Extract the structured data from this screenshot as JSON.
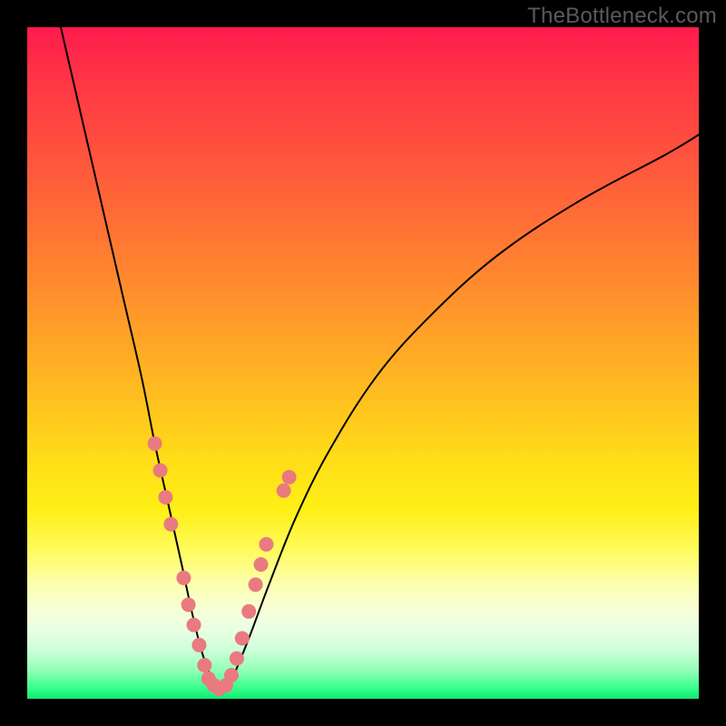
{
  "watermark": "TheBottleneck.com",
  "chart_data": {
    "type": "line",
    "title": "",
    "xlabel": "",
    "ylabel": "",
    "xlim": [
      0,
      100
    ],
    "ylim": [
      0,
      100
    ],
    "grid": false,
    "legend": false,
    "background_gradient": {
      "direction": "vertical",
      "stops": [
        {
          "pos": 0.0,
          "color": "#ff1a4d"
        },
        {
          "pos": 0.22,
          "color": "#ff5b3b"
        },
        {
          "pos": 0.52,
          "color": "#ffb522"
        },
        {
          "pos": 0.78,
          "color": "#fffb60"
        },
        {
          "pos": 0.93,
          "color": "#c9ffd6"
        },
        {
          "pos": 1.0,
          "color": "#11e873"
        }
      ]
    },
    "series": [
      {
        "name": "bottleneck-curve",
        "stroke": "#000000",
        "stroke_width": 2,
        "x": [
          5,
          8,
          11,
          14,
          17,
          19,
          21,
          23,
          24.5,
          26,
          27.5,
          29,
          30.5,
          33,
          36,
          40,
          45,
          52,
          60,
          70,
          82,
          95,
          100
        ],
        "y": [
          100,
          87,
          74,
          61,
          48,
          38,
          29,
          20,
          13,
          7,
          3,
          1,
          3,
          9,
          17,
          27,
          37,
          48,
          57,
          66,
          74,
          81,
          84
        ]
      }
    ],
    "markers": {
      "color": "#e97a7f",
      "radius": 8,
      "points": [
        {
          "x": 19.0,
          "y": 38
        },
        {
          "x": 19.8,
          "y": 34
        },
        {
          "x": 20.6,
          "y": 30
        },
        {
          "x": 21.4,
          "y": 26
        },
        {
          "x": 23.3,
          "y": 18
        },
        {
          "x": 24.0,
          "y": 14
        },
        {
          "x": 24.8,
          "y": 11
        },
        {
          "x": 25.6,
          "y": 8
        },
        {
          "x": 26.4,
          "y": 5
        },
        {
          "x": 27.0,
          "y": 3
        },
        {
          "x": 27.8,
          "y": 2
        },
        {
          "x": 28.6,
          "y": 1.5
        },
        {
          "x": 29.6,
          "y": 2
        },
        {
          "x": 30.4,
          "y": 3.5
        },
        {
          "x": 31.2,
          "y": 6
        },
        {
          "x": 32.0,
          "y": 9
        },
        {
          "x": 33.0,
          "y": 13
        },
        {
          "x": 34.0,
          "y": 17
        },
        {
          "x": 34.8,
          "y": 20
        },
        {
          "x": 35.6,
          "y": 23
        },
        {
          "x": 38.2,
          "y": 31
        },
        {
          "x": 39.0,
          "y": 33
        }
      ]
    }
  }
}
